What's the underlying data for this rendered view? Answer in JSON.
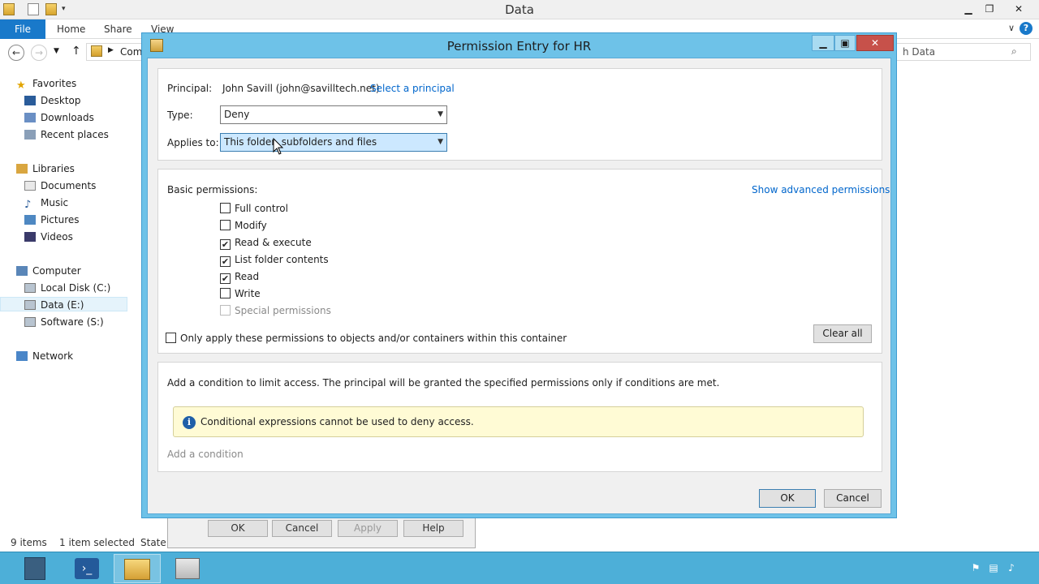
{
  "explorer": {
    "title": "Data",
    "ribbon_tabs": [
      "File",
      "Home",
      "Share",
      "View"
    ],
    "address_partial": "Com",
    "search_placeholder": "h Data",
    "nav": {
      "favorites": "Favorites",
      "desktop": "Desktop",
      "downloads": "Downloads",
      "recent": "Recent places",
      "libraries": "Libraries",
      "documents": "Documents",
      "music": "Music",
      "pictures": "Pictures",
      "videos": "Videos",
      "computer": "Computer",
      "local_disk": "Local Disk (C:)",
      "data_e": "Data (E:)",
      "software_s": "Software (S:)",
      "network": "Network"
    },
    "status": {
      "items": "9 items",
      "selected": "1 item selected",
      "state": "State:"
    }
  },
  "background_dialog": {
    "ok": "OK",
    "cancel": "Cancel",
    "apply": "Apply",
    "help": "Help"
  },
  "dialog": {
    "title": "Permission Entry for HR",
    "principal_label": "Principal:",
    "principal_value": "John Savill (john@savilltech.net)",
    "select_principal": "Select a principal",
    "type_label": "Type:",
    "type_value": "Deny",
    "applies_label": "Applies to:",
    "applies_value": "This folder, subfolders and files",
    "basic_permissions": "Basic permissions:",
    "show_advanced": "Show advanced permissions",
    "permissions": [
      {
        "label": "Full control",
        "checked": false,
        "disabled": false
      },
      {
        "label": "Modify",
        "checked": false,
        "disabled": false
      },
      {
        "label": "Read & execute",
        "checked": true,
        "disabled": false
      },
      {
        "label": "List folder contents",
        "checked": true,
        "disabled": false
      },
      {
        "label": "Read",
        "checked": true,
        "disabled": false
      },
      {
        "label": "Write",
        "checked": false,
        "disabled": false
      },
      {
        "label": "Special permissions",
        "checked": false,
        "disabled": true
      }
    ],
    "only_apply": "Only apply these permissions to objects and/or containers within this container",
    "clear_all": "Clear all",
    "condition_desc": "Add a condition to limit access. The principal will be granted the specified permissions only if conditions are met.",
    "info_message": "Conditional expressions cannot be used to deny access.",
    "add_condition": "Add a condition",
    "ok": "OK",
    "cancel": "Cancel"
  },
  "colors": {
    "dialog_frame": "#6ec2e8",
    "taskbar": "#4dafd8",
    "link": "#0066cc",
    "info_bg": "#fffbd5"
  }
}
